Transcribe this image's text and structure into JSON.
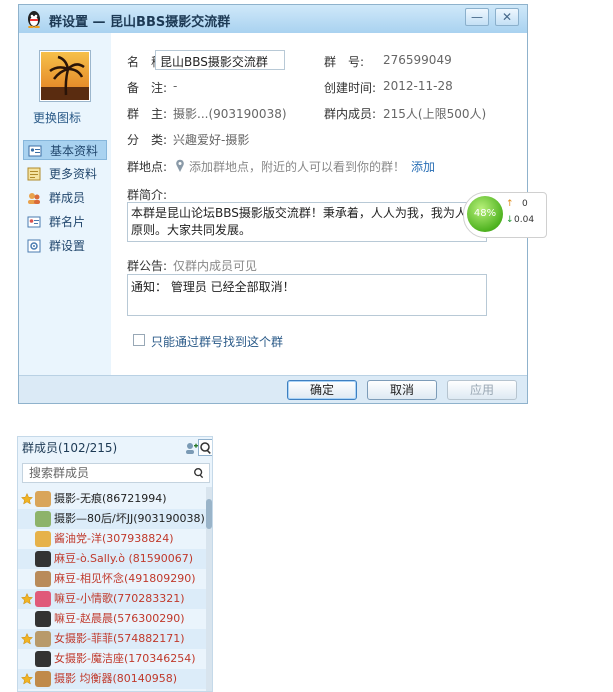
{
  "dialog": {
    "title": "群设置 — 昆山BBS摄影交流群",
    "change_icon": "更换图标",
    "nav": [
      {
        "label": "基本资料",
        "icon": "profile-card-icon",
        "active": true
      },
      {
        "label": "更多资料",
        "icon": "more-info-icon",
        "active": false
      },
      {
        "label": "群成员",
        "icon": "members-icon",
        "active": false
      },
      {
        "label": "群名片",
        "icon": "name-card-icon",
        "active": false
      },
      {
        "label": "群设置",
        "icon": "settings-icon",
        "active": false
      }
    ],
    "info": {
      "name_label": "名　称:",
      "name_value": "昆山BBS摄影交流群",
      "number_label": "群　号:",
      "number_value": "276599049",
      "note_label": "备　注:",
      "note_value": "-",
      "created_label": "创建时间:",
      "created_value": "2012-11-28",
      "owner_label": "群　主:",
      "owner_value": "摄影...(903190038)",
      "members_label": "群内成员:",
      "members_value": "215人(上限500人)",
      "category_label": "分　类:",
      "category_value": "兴趣爱好-摄影",
      "location_label": "群地点:",
      "location_placeholder": "添加群地点，附近的人可以看到你的群！",
      "location_add": "添加",
      "intro_label": "群简介:",
      "intro_text": "本群是昆山论坛BBS摄影版交流群！秉承着，人人为我，我为人人原则。大家共同发展。",
      "notice_label": "群公告:",
      "notice_hint": "仅群内成员可见",
      "notice_text": "通知： 管理员 已经全部取消！",
      "checkbox_label": "只能通过群号找到这个群"
    },
    "speed": {
      "percent": "48%",
      "up": "0",
      "down": "0.04"
    },
    "buttons": {
      "ok": "确定",
      "cancel": "取消",
      "apply": "应用"
    }
  },
  "members": {
    "header": "群成员(102/215)",
    "search_placeholder": "搜索群成员",
    "list": [
      {
        "name": "摄影-无痕(86721994)",
        "color": "#222222",
        "star": true
      },
      {
        "name": "摄影—80后/坏JJ(903190038)",
        "color": "#222222",
        "star": false
      },
      {
        "name": "酱油党-洋(307938824)",
        "color": "#c0392b",
        "star": false
      },
      {
        "name": "麻豆-ò.Sally.ò (81590067)",
        "color": "#c0392b",
        "star": false
      },
      {
        "name": "麻豆-相见怀念(491809290)",
        "color": "#c0392b",
        "star": false
      },
      {
        "name": "嘛豆-小情歌(770283321)",
        "color": "#c0392b",
        "star": true
      },
      {
        "name": "嘛豆-赵晨晨(576300290)",
        "color": "#c0392b",
        "star": false
      },
      {
        "name": "女摄影-菲菲(574882171)",
        "color": "#c0392b",
        "star": true
      },
      {
        "name": "女摄影-魔洁座(170346254)",
        "color": "#c0392b",
        "star": false
      },
      {
        "name": "摄影 均衡器(80140958)",
        "color": "#c0392b",
        "star": true
      }
    ]
  }
}
